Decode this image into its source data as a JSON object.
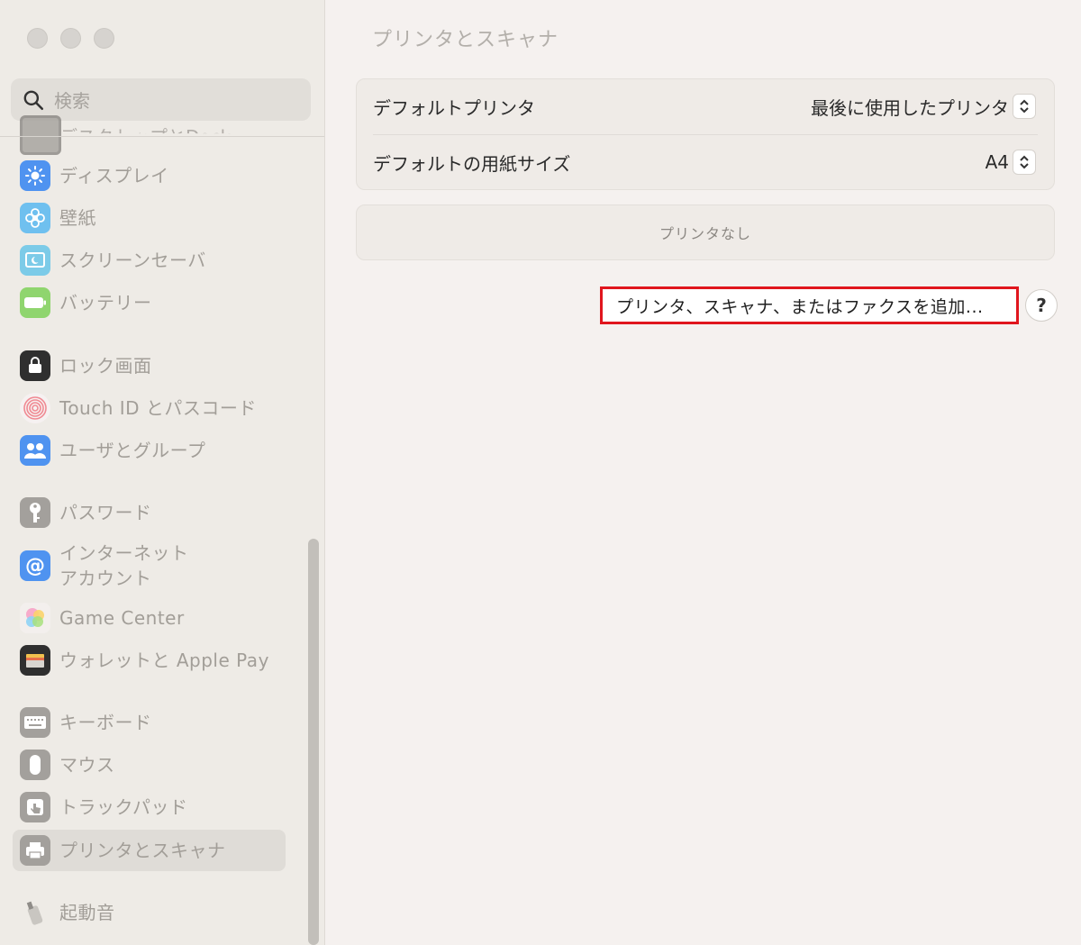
{
  "window": {
    "title": "プリンタとスキャナ"
  },
  "search": {
    "placeholder": "検索"
  },
  "sidebar": {
    "partial_item_label": "デスクトップとDock",
    "items": [
      {
        "label": "ディスプレイ",
        "icon": "display-icon"
      },
      {
        "label": "壁紙",
        "icon": "wallpaper-icon"
      },
      {
        "label": "スクリーンセーバ",
        "icon": "screensaver-icon"
      },
      {
        "label": "バッテリー",
        "icon": "battery-icon"
      },
      {
        "label": "ロック画面",
        "icon": "lock-icon"
      },
      {
        "label": "Touch ID とパスコード",
        "icon": "fingerprint-icon"
      },
      {
        "label": "ユーザとグループ",
        "icon": "users-icon"
      },
      {
        "label": "パスワード",
        "icon": "key-icon"
      },
      {
        "label": "インターネット\nアカウント",
        "icon": "at-icon"
      },
      {
        "label": "Game Center",
        "icon": "game-center-icon"
      },
      {
        "label": "ウォレットと Apple Pay",
        "icon": "wallet-icon"
      },
      {
        "label": "キーボード",
        "icon": "keyboard-icon"
      },
      {
        "label": "マウス",
        "icon": "mouse-icon"
      },
      {
        "label": "トラックパッド",
        "icon": "trackpad-icon"
      },
      {
        "label": "プリンタとスキャナ",
        "icon": "printer-icon",
        "selected": true
      },
      {
        "label": "起動音",
        "icon": "startup-sound-icon"
      }
    ]
  },
  "settings": {
    "default_printer_label": "デフォルトプリンタ",
    "default_printer_value": "最後に使用したプリンタ",
    "paper_size_label": "デフォルトの用紙サイズ",
    "paper_size_value": "A4"
  },
  "printers": {
    "empty_text": "プリンタなし"
  },
  "actions": {
    "add_label": "プリンタ、スキャナ、またはファクスを追加...",
    "help_label": "?"
  },
  "colors": {
    "highlight": "#e0161d",
    "sidebar_bg": "#eeebe6",
    "main_bg": "#f5f1ef"
  }
}
